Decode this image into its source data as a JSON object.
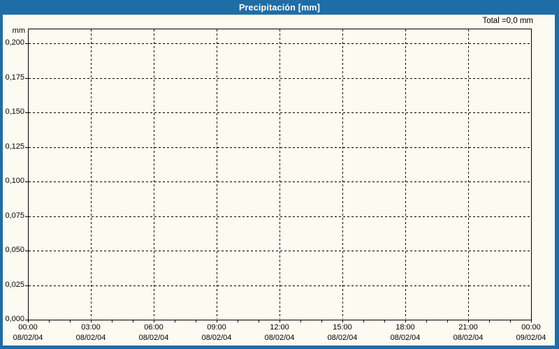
{
  "header": {
    "title": "Precipitación [mm]"
  },
  "annotations": {
    "total": "Total =0,0 mm"
  },
  "chart_data": {
    "type": "line",
    "title": "Precipitación [mm]",
    "xlabel": "",
    "ylabel": "mm",
    "ylim": [
      0,
      0.211
    ],
    "x_range": [
      "08/02/04 00:00",
      "09/02/04 00:00"
    ],
    "grid": "dashed black; horizontal lines every 0,025 mm; vertical lines every 3 h; minor x ticks hourly",
    "legend": "none",
    "y_ticks": [
      {
        "label": "0,200",
        "value": 0.2
      },
      {
        "label": "0,175",
        "value": 0.175
      },
      {
        "label": "0,150",
        "value": 0.15
      },
      {
        "label": "0,125",
        "value": 0.125
      },
      {
        "label": "0,100",
        "value": 0.1
      },
      {
        "label": "0,075",
        "value": 0.075
      },
      {
        "label": "0,050",
        "value": 0.05
      },
      {
        "label": "0,025",
        "value": 0.025
      },
      {
        "label": "0,000",
        "value": 0.0
      }
    ],
    "x_ticks": [
      {
        "time": "00:00",
        "date": "08/02/04"
      },
      {
        "time": "03:00",
        "date": "08/02/04"
      },
      {
        "time": "06:00",
        "date": "08/02/04"
      },
      {
        "time": "09:00",
        "date": "08/02/04"
      },
      {
        "time": "12:00",
        "date": "08/02/04"
      },
      {
        "time": "15:00",
        "date": "08/02/04"
      },
      {
        "time": "18:00",
        "date": "08/02/04"
      },
      {
        "time": "21:00",
        "date": "08/02/04"
      },
      {
        "time": "00:00",
        "date": "09/02/04"
      }
    ],
    "series": [
      {
        "name": "Precipitación",
        "values": []
      }
    ],
    "total_mm": 0.0
  },
  "colors": {
    "frame_blue": "#1f6da6",
    "titlebar_blue": "#1f6da6",
    "title_text": "#ffffff",
    "background_cream": "#fbfbf1",
    "grid_and_axis": "#000000",
    "label_text": "#000000"
  }
}
